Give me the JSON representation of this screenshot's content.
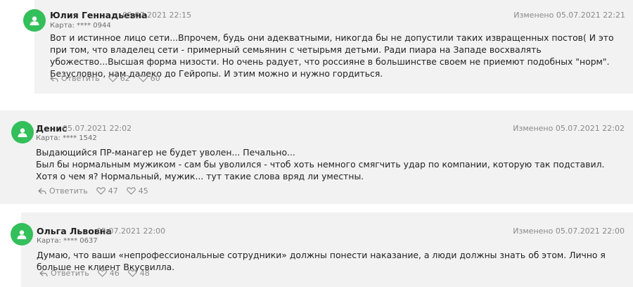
{
  "comments": [
    {
      "author": "Юлия Геннадьевна",
      "date": "05.07.2021 22:15",
      "card": "Карта: **** 0944",
      "edited": "Изменено 05.07.2021 22:21",
      "text": [
        "Вот и истинное лицо сети...Впрочем, будь они адекватными, никогда бы не допустили таких извращенных постов( И это при том, что владелец сети - примерный семьянин с четырьмя детьми. Ради пиара на Западе восхвалять убожество...Высшая форма низости. Но очень радует, что россияне в большинстве своем не приемют подобных \"норм\". Безусловно, нам далеко до Гейропы. И этим можно и нужно гордиться."
      ],
      "reply_label": "Ответить",
      "likes": "62",
      "hearts": "60"
    },
    {
      "author": "Денис",
      "date": "05.07.2021 22:02",
      "card": "Карта: **** 1542",
      "edited": "Изменено 05.07.2021 22:02",
      "text": [
        "Выдающийся ПР-манагер не будет уволен... Печально...",
        "Был бы нормальным мужиком - сам бы уволился - чтоб хоть немного смягчить удар по компании, которую так подставил. Хотя о чем я? Нормальный, мужик... тут такие слова вряд ли уместны."
      ],
      "reply_label": "Ответить",
      "likes": "47",
      "hearts": "45"
    },
    {
      "author": "Ольга Львовна",
      "date": "05.07.2021 22:00",
      "card": "Карта: **** 0637",
      "edited": "Изменено 05.07.2021 22:00",
      "text": [
        "Думаю, что ваши «непрофессиональные сотрудники» должны понести наказание, а люди должны знать об этом. Лично я больше не клиент Вкусвилла."
      ],
      "reply_label": "Ответить",
      "likes": "46",
      "hearts": "48"
    }
  ],
  "colors": {
    "avatar": "#33bf5a",
    "card_bg": "#f2f2f2",
    "muted": "#8a8a8a"
  },
  "icons": {
    "avatar": "user-icon",
    "reply": "reply-arrow-icon",
    "like": "heart-outline-icon",
    "heart": "heart-outline-icon"
  }
}
